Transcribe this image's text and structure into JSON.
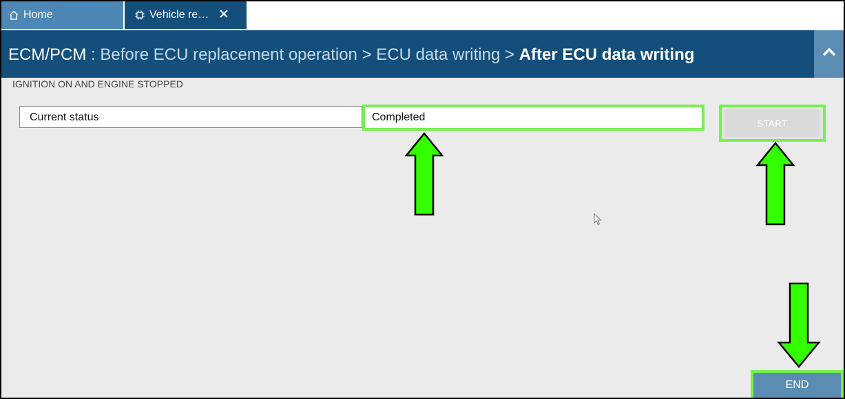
{
  "tabs": [
    {
      "label": "Home",
      "icon": "home-icon"
    },
    {
      "label": "Vehicle re…",
      "icon": "chip-icon",
      "close_icon": "close-icon"
    }
  ],
  "breadcrumb": {
    "module": "ECM/PCM",
    "separator_colon": " : ",
    "steps": [
      "Before ECU replacement operation",
      "ECU data writing"
    ],
    "sep": " > ",
    "current": "After ECU data writing"
  },
  "condition": "IGNITION ON AND ENGINE STOPPED",
  "status": {
    "label": "Current status",
    "value": "Completed"
  },
  "buttons": {
    "start": "START",
    "end": "END"
  },
  "colors": {
    "header_bg": "#144f7c",
    "tab_home_bg": "#4c87b5",
    "highlight_green": "#77f051",
    "end_button_bg": "#5b8db3"
  },
  "icons": {
    "collapse": "chevron-up-icon",
    "annotation_arrow": "green-arrow-icon",
    "cursor": "mouse-pointer-icon"
  }
}
